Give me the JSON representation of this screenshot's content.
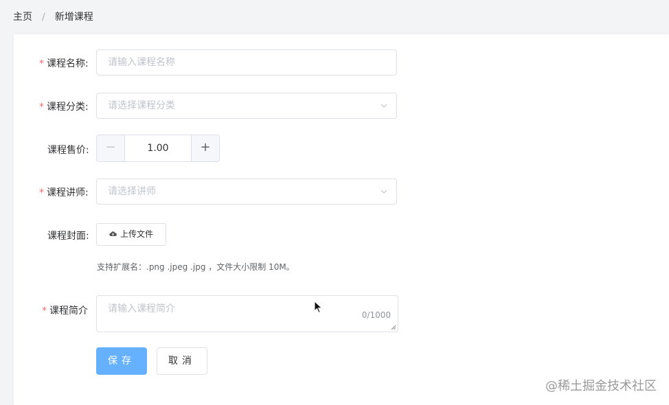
{
  "breadcrumb": {
    "home": "主页",
    "separator": "/",
    "current": "新增课程"
  },
  "form": {
    "required_mark": "*",
    "name": {
      "label": "课程名称:",
      "placeholder": "请输入课程名称"
    },
    "category": {
      "label": "课程分类:",
      "placeholder": "请选择课程分类"
    },
    "price": {
      "label": "课程售价:",
      "value": "1.00",
      "minus": "−",
      "plus": "+"
    },
    "teacher": {
      "label": "课程讲师:",
      "placeholder": "请选择讲师"
    },
    "cover": {
      "label": "课程封面:",
      "button_label": "上传文件",
      "hint": "支持扩展名：.png .jpeg .jpg ，文件大小限制 10M。"
    },
    "intro": {
      "label": "课程简介",
      "placeholder": "请输入课程简介",
      "counter": "0/1000"
    },
    "save_label": "保存",
    "cancel_label": "取消"
  },
  "watermark": "@稀土掘金技术社区",
  "colors": {
    "primary": "#66b1ff",
    "required": "#f56c6c",
    "border": "#dcdfe6",
    "placeholder": "#c0c4cc"
  },
  "icons": {
    "select_arrow": "chevron-down-icon",
    "upload": "cloud-upload-icon",
    "cursor": "mouse-cursor-icon"
  }
}
